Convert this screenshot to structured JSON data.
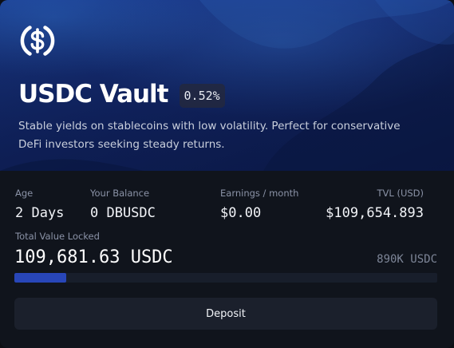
{
  "vault": {
    "title": "USDC Vault",
    "apy_badge": "0.52%",
    "description": "Stable yields on stablecoins with low volatility. Perfect for conservative DeFi investors seeking steady returns.",
    "logo_icon": "usdc-dollar-circle-icon",
    "accent_color": "#2846b8",
    "hero_color": "#13276a"
  },
  "stats": {
    "age": {
      "label": "Age",
      "value": "2 Days"
    },
    "balance": {
      "label": "Your Balance",
      "value": "0 DBUSDC"
    },
    "earnings": {
      "label": "Earnings / month",
      "value": "$0.00"
    },
    "tvl_usd": {
      "label": "TVL (USD)",
      "value": "$109,654.893"
    }
  },
  "tvl": {
    "label": "Total Value Locked",
    "value": "109,681.63 USDC",
    "cap": "890K USDC",
    "progress": 0.123
  },
  "actions": {
    "deposit_label": "Deposit"
  }
}
